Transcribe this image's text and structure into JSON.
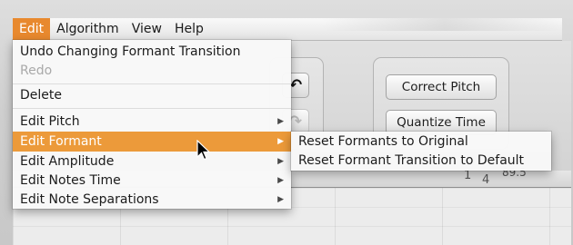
{
  "menubar": {
    "items": [
      {
        "label": "Edit"
      },
      {
        "label": "Algorithm"
      },
      {
        "label": "View"
      },
      {
        "label": "Help"
      }
    ]
  },
  "edit_menu": {
    "items": [
      {
        "label": "Undo Changing Formant Transition",
        "enabled": true,
        "submenu": false
      },
      {
        "label": "Redo",
        "enabled": false,
        "submenu": false
      },
      {
        "label": "Delete",
        "enabled": true,
        "submenu": false
      },
      {
        "label": "Edit Pitch",
        "enabled": true,
        "submenu": true
      },
      {
        "label": "Edit Formant",
        "enabled": true,
        "submenu": true,
        "highlighted": true
      },
      {
        "label": "Edit Amplitude",
        "enabled": true,
        "submenu": true
      },
      {
        "label": "Edit Notes Time",
        "enabled": true,
        "submenu": true
      },
      {
        "label": "Edit Note Separations",
        "enabled": true,
        "submenu": true
      }
    ]
  },
  "formant_submenu": {
    "items": [
      {
        "label": "Reset Formants to Original"
      },
      {
        "label": "Reset Formant Transition to Default"
      }
    ]
  },
  "toolbar": {
    "undo_icon": "undo-arrow-icon",
    "redo_icon": "redo-arrow-icon",
    "correct_pitch_label": "Correct Pitch",
    "quantize_time_label": "Quantize Time"
  },
  "ruler": {
    "bar_number": "1",
    "beat_number": "4",
    "value": "89.5"
  },
  "colors": {
    "menu_highlight": "#ec9a3a",
    "active_menu_title": "#e8892e"
  }
}
